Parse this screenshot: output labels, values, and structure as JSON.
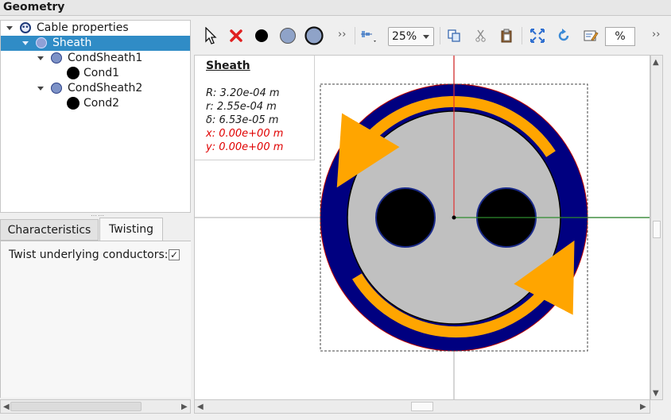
{
  "window": {
    "title": "Geometry"
  },
  "tree": {
    "items": [
      {
        "label": "Cable properties"
      },
      {
        "label": "Sheath"
      },
      {
        "label": "CondSheath1"
      },
      {
        "label": "Cond1"
      },
      {
        "label": "CondSheath2"
      },
      {
        "label": "Cond2"
      }
    ],
    "selected": "Sheath"
  },
  "tabs": {
    "characteristics": "Characteristics",
    "twisting": "Twisting",
    "active": "Twisting"
  },
  "twisting": {
    "label": "Twist underlying conductors:",
    "checked": true,
    "check_glyph": "✓"
  },
  "toolbar": {
    "zoom": "25%",
    "percent_field": "%",
    "more_glyph": "››",
    "icons": [
      "select-arrow-icon",
      "delete-icon",
      "add-conductor-icon",
      "add-insulator-icon",
      "add-sheath-icon",
      "more-icon",
      "align-icon",
      "copy-icon",
      "cut-icon",
      "paste-icon",
      "fit-view-icon",
      "refresh-icon",
      "edit-icon",
      "more-icon"
    ]
  },
  "info": {
    "title": "Sheath",
    "R": "R: 3.20e-04 m",
    "r": "r: 2.55e-04 m",
    "delta": "δ: 6.53e-05 m",
    "x": "x: 0.00e+00 m",
    "y": "y: 0.00e+00 m"
  },
  "colors": {
    "sheath_outer": "#000080",
    "sheath_inner": "#c0c0c0",
    "twist_arrow": "#ffa500",
    "conductor": "#000000",
    "x_axis": "#2e8b2e",
    "y_axis": "#e03030",
    "selection": "#308cc6",
    "coord_text": "#e00000"
  }
}
